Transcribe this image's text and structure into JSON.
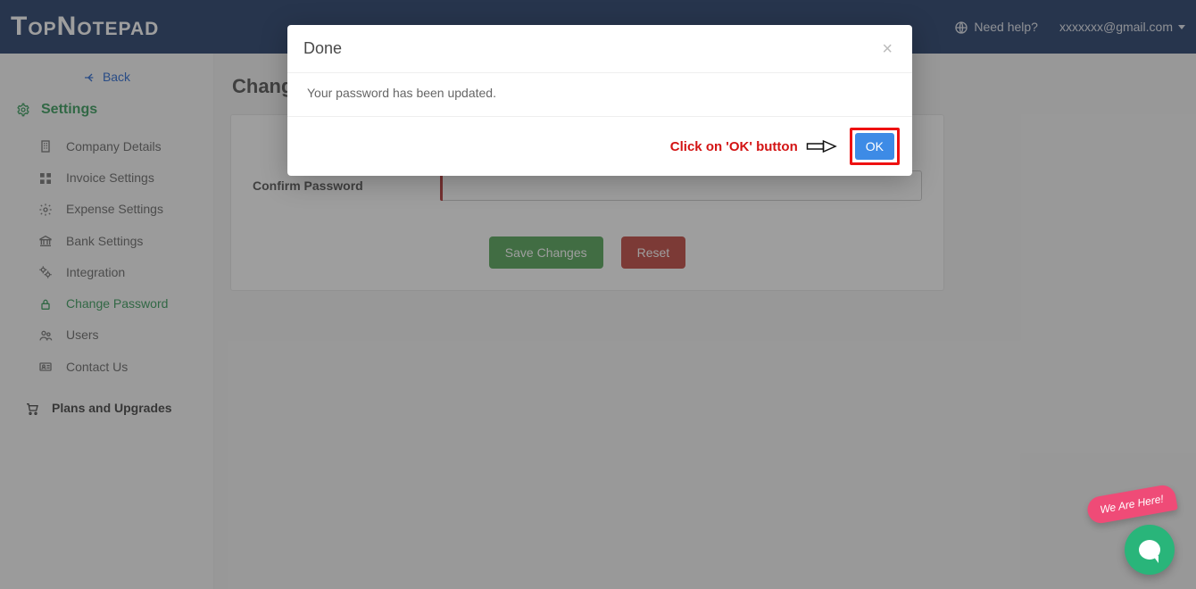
{
  "brand": "TopNotepad",
  "header": {
    "help": "Need help?",
    "email": "xxxxxxx@gmail.com"
  },
  "sidebar": {
    "back": "Back",
    "settings": "Settings",
    "items": [
      {
        "label": "Company Details",
        "icon": "company"
      },
      {
        "label": "Invoice Settings",
        "icon": "invoice"
      },
      {
        "label": "Expense Settings",
        "icon": "expense"
      },
      {
        "label": "Bank Settings",
        "icon": "bank"
      },
      {
        "label": "Integration",
        "icon": "integration"
      },
      {
        "label": "Change Password",
        "icon": "lock",
        "active": true
      },
      {
        "label": "Users",
        "icon": "users"
      },
      {
        "label": "Contact Us",
        "icon": "contact"
      }
    ],
    "plans": "Plans and Upgrades"
  },
  "page": {
    "title": "Change",
    "confirm_label": "Confirm Password",
    "save": "Save Changes",
    "reset": "Reset"
  },
  "modal": {
    "title": "Done",
    "body": "Your password has been updated.",
    "ok": "OK"
  },
  "annotation": {
    "text": "Click on 'OK' button"
  },
  "chat": {
    "tag": "We Are Here!"
  }
}
